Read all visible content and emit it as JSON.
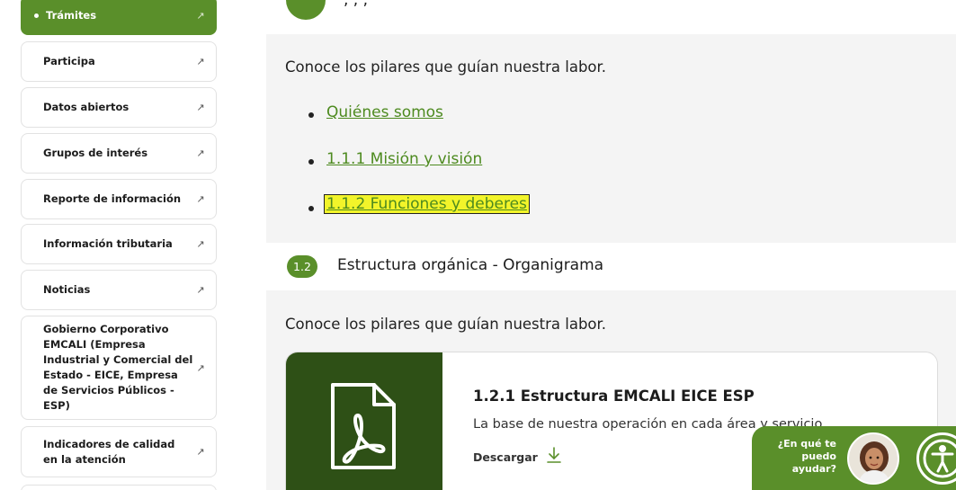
{
  "sidebar": {
    "items": [
      {
        "label": "Trámites",
        "active": true
      },
      {
        "label": "Participa"
      },
      {
        "label": "Datos abiertos"
      },
      {
        "label": "Grupos de interés"
      },
      {
        "label": "Reporte de información"
      },
      {
        "label": "Información tributaria"
      },
      {
        "label": "Noticias"
      },
      {
        "label": "Gobierno Corporativo EMCALI (Empresa Industrial y Comercial del Estado - EICE, Empresa de Servicios Públicos - ESP)"
      },
      {
        "label": "Indicadores de calidad en la atención"
      }
    ],
    "arrow_icon": "arrow-up-right-icon"
  },
  "main": {
    "top_title": ", , ,",
    "intro_1": "Conoce los pilares que guían nuestra labor.",
    "links": [
      {
        "label": "Quiénes somos"
      },
      {
        "label": "1.1.1 Misión y visión"
      },
      {
        "label": "1.1.2 Funciones y deberes",
        "focused": true
      }
    ],
    "section": {
      "number": "1.2",
      "title": "Estructura orgánica - Organigrama"
    },
    "intro_2": "Conoce los pilares que guían nuestra labor.",
    "card": {
      "icon": "pdf-file-icon",
      "title": "1.2.1 Estructura EMCALI EICE ESP",
      "description": "La base de nuestra operación en cada área y servicio.",
      "download_label": "Descargar",
      "download_icon": "download-arrow-icon"
    }
  },
  "help_widget": {
    "text": "¿En qué te puedo ayudar?",
    "avatar_icon": "assistant-avatar-icon",
    "accessibility_icon": "accessibility-icon"
  },
  "colors": {
    "brand_green": "#5a8f2a",
    "dark_green": "#2e5016",
    "link_green": "#4d8a1f",
    "focus_highlight": "#f2f42a"
  }
}
